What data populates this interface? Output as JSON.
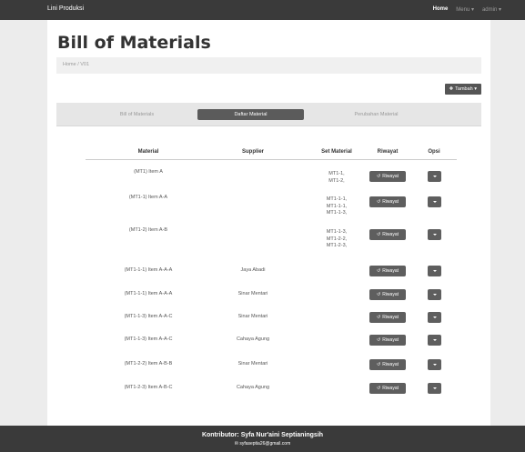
{
  "navbar": {
    "brand": "Lini Produksi",
    "home": "Home",
    "menu": "Menu ▾",
    "user": "admin ▾"
  },
  "page": {
    "title": "Bill of Materials",
    "breadcrumb": "Home / V01",
    "add_label": "Tambah ▾"
  },
  "tabs": [
    "Bill of Materials",
    "Daftar Material",
    "Perubahan Material"
  ],
  "table": {
    "headers": [
      "Material",
      "Supplier",
      "Set Material",
      "Riwayat",
      "Opsi"
    ],
    "riwayat_label": "Riwayat",
    "rows": [
      {
        "material": "(MT1) Item A",
        "supplier": "",
        "set": [
          "MT1-1,",
          "MT1-2,"
        ]
      },
      {
        "material": "(MT1-1) Item A-A",
        "supplier": "",
        "set": [
          "MT1-1-1,",
          "MT1-1-1,",
          "MT1-1-3,"
        ]
      },
      {
        "material": "(MT1-2) Item A-B",
        "supplier": "",
        "set": [
          "MT1-1-3,",
          "MT1-2-2,",
          "MT1-2-3,"
        ]
      },
      {
        "material": "(MT1-1-1) Item A-A-A",
        "supplier": "Jaya Abadi",
        "set": []
      },
      {
        "material": "(MT1-1-1) Item A-A-A",
        "supplier": "Sinar Mentari",
        "set": []
      },
      {
        "material": "(MT1-1-3) Item A-A-C",
        "supplier": "Sinar Mentari",
        "set": []
      },
      {
        "material": "(MT1-1-3) Item A-A-C",
        "supplier": "Cahaya Agung",
        "set": []
      },
      {
        "material": "(MT1-2-2) Item A-B-B",
        "supplier": "Sinar Mentari",
        "set": []
      },
      {
        "material": "(MT1-2-3) Item A-B-C",
        "supplier": "Cahaya Agung",
        "set": []
      }
    ]
  },
  "footer": {
    "title": "Kontributor: Syfa Nur'aini Septianingsih",
    "email": "✉ syfaseptia26@gmail.com"
  },
  "colors": {
    "navbar": "#3a3a3a",
    "active_tab": "#5b5b5b",
    "button": "#5e5e5e"
  }
}
